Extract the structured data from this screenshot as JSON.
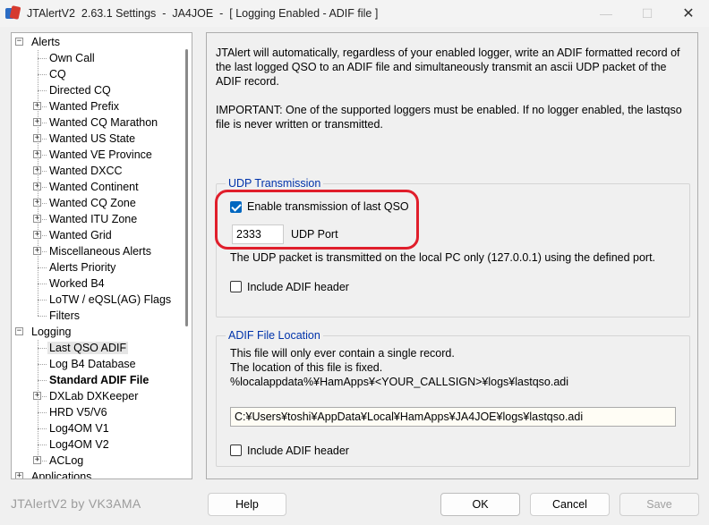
{
  "window": {
    "title": "JTAlertV2  2.63.1 Settings  -  JA4JOE  -  [ Logging Enabled - ADIF file ]",
    "min_icon": "minimize-icon",
    "max_icon": "maximize-icon",
    "close_icon": "close-icon"
  },
  "tree": {
    "items": [
      {
        "label": "Alerts",
        "level": 0,
        "expander": "minus"
      },
      {
        "label": "Own Call",
        "level": 1,
        "expander": null
      },
      {
        "label": "CQ",
        "level": 1,
        "expander": null
      },
      {
        "label": "Directed CQ",
        "level": 1,
        "expander": null
      },
      {
        "label": "Wanted Prefix",
        "level": 1,
        "expander": "plus"
      },
      {
        "label": "Wanted CQ Marathon",
        "level": 1,
        "expander": "plus"
      },
      {
        "label": "Wanted US State",
        "level": 1,
        "expander": "plus"
      },
      {
        "label": "Wanted VE Province",
        "level": 1,
        "expander": "plus"
      },
      {
        "label": "Wanted DXCC",
        "level": 1,
        "expander": "plus"
      },
      {
        "label": "Wanted Continent",
        "level": 1,
        "expander": "plus"
      },
      {
        "label": "Wanted CQ Zone",
        "level": 1,
        "expander": "plus"
      },
      {
        "label": "Wanted ITU Zone",
        "level": 1,
        "expander": "plus"
      },
      {
        "label": "Wanted Grid",
        "level": 1,
        "expander": "plus"
      },
      {
        "label": "Miscellaneous Alerts",
        "level": 1,
        "expander": "plus"
      },
      {
        "label": "Alerts Priority",
        "level": 1,
        "expander": null
      },
      {
        "label": "Worked B4",
        "level": 1,
        "expander": null
      },
      {
        "label": "LoTW / eQSL(AG) Flags",
        "level": 1,
        "expander": null
      },
      {
        "label": "Filters",
        "level": 1,
        "expander": null
      },
      {
        "label": "Logging",
        "level": 0,
        "expander": "minus"
      },
      {
        "label": "Last QSO ADIF",
        "level": 1,
        "expander": null,
        "selected": true
      },
      {
        "label": "Log B4 Database",
        "level": 1,
        "expander": null
      },
      {
        "label": "Standard ADIF File",
        "level": 1,
        "expander": null,
        "bold": true
      },
      {
        "label": "DXLab DXKeeper",
        "level": 1,
        "expander": "plus"
      },
      {
        "label": "HRD V5/V6",
        "level": 1,
        "expander": null
      },
      {
        "label": "Log4OM V1",
        "level": 1,
        "expander": null
      },
      {
        "label": "Log4OM V2",
        "level": 1,
        "expander": null
      },
      {
        "label": "ACLog",
        "level": 1,
        "expander": "plus"
      },
      {
        "label": "Applications",
        "level": 0,
        "expander": "plus"
      }
    ]
  },
  "panel": {
    "intro": "JTAlert will automatically, regardless of your enabled logger, write an ADIF formatted record of the last logged QSO to an ADIF file and simultaneously transmit an ascii UDP packet of the ADIF record.",
    "important": "IMPORTANT: One of the supported loggers must be enabled. If no logger enabled, the lastqso file is never written or transmitted.",
    "udp": {
      "title": "UDP Transmission",
      "enable_label": "Enable transmission of last QSO",
      "enable_checked": true,
      "port_value": "2333",
      "port_label": "UDP Port",
      "note": "The UDP packet is transmitted on the local PC only (127.0.0.1) using the defined port.",
      "header_label": "Include ADIF header",
      "header_checked": false
    },
    "file": {
      "title": "ADIF File Location",
      "line1": "This file will only ever contain a single record.",
      "line2": "The location of this file is fixed.",
      "line3": "%localappdata%¥HamApps¥<YOUR_CALLSIGN>¥logs¥lastqso.adi",
      "path_value": "C:¥Users¥toshi¥AppData¥Local¥HamApps¥JA4JOE¥logs¥lastqso.adi",
      "header_label": "Include ADIF header",
      "header_checked": false
    }
  },
  "footer": {
    "brand": "JTAlertV2 by VK3AMA",
    "help_label": "Help",
    "ok_label": "OK",
    "cancel_label": "Cancel",
    "save_label": "Save"
  },
  "colors": {
    "accent": "#0067c0",
    "group_title": "#0033aa",
    "highlight": "#e01e2b"
  }
}
